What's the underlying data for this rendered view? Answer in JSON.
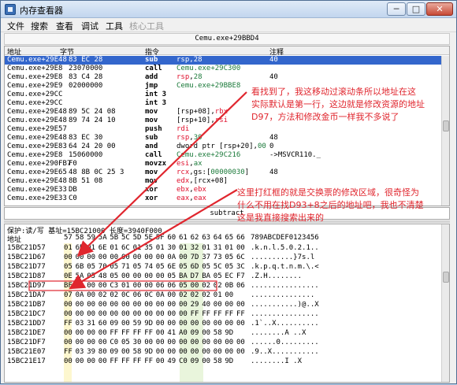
{
  "window": {
    "title": "内存查看器",
    "min_label": "─",
    "max_label": "□",
    "close_label": "✕"
  },
  "menu": [
    "文件",
    "搜索",
    "查看",
    "调试",
    "工具",
    "核心工具"
  ],
  "disasm": {
    "address_label": "Cemu.exe+29BBD4",
    "headers": {
      "address": "地址",
      "bytes": "字节",
      "opcode": "指令",
      "comment": "注释"
    },
    "rows": [
      {
        "addr": "Cemu.exe+29E48",
        "bytes": "83 EC 28",
        "mn": "sub",
        "op": [
          [
            "reg",
            "rsp"
          ],
          [
            "",
            ","
          ],
          [
            "num",
            "28"
          ]
        ],
        "cm": "40"
      },
      {
        "addr": "Cemu.exe+29E8",
        "bytes": "23070000",
        "mn": "call",
        "op": [
          [
            "grn",
            "Cemu.exe+29C300"
          ]
        ],
        "cm": ""
      },
      {
        "addr": "Cemu.exe+29E8",
        "bytes": "83 C4 28",
        "mn": "add",
        "op": [
          [
            "reg",
            "rsp"
          ],
          [
            "",
            ","
          ],
          [
            "num",
            "28"
          ]
        ],
        "cm": "40"
      },
      {
        "addr": "Cemu.exe+29E9",
        "bytes": "02000000",
        "mn": "jmp",
        "op": [
          [
            "grn",
            "Cemu.exe+29BBE8"
          ]
        ],
        "cm": ""
      },
      {
        "addr": "Cemu.exe+29CC",
        "bytes": "",
        "mn": "int 3",
        "op": [],
        "cm": ""
      },
      {
        "addr": "Cemu.exe+29CC",
        "bytes": "",
        "mn": "int 3",
        "op": [],
        "cm": ""
      },
      {
        "addr": "Cemu.exe+29E48",
        "bytes": "89 5C 24 08",
        "mn": "mov",
        "op": [
          [
            "",
            "[rsp+08],"
          ],
          [
            "reg",
            "rbx"
          ]
        ],
        "cm": ""
      },
      {
        "addr": "Cemu.exe+29E48",
        "bytes": "89 74 24 10",
        "mn": "mov",
        "op": [
          [
            "",
            "[rsp+10],"
          ],
          [
            "reg",
            "rsi"
          ]
        ],
        "cm": ""
      },
      {
        "addr": "Cemu.exe+29E57",
        "bytes": "",
        "mn": "push",
        "op": [
          [
            "reg",
            "rdi"
          ]
        ],
        "cm": ""
      },
      {
        "addr": "Cemu.exe+29E48",
        "bytes": "83 EC 30",
        "mn": "sub",
        "op": [
          [
            "reg",
            "rsp"
          ],
          [
            "",
            ","
          ],
          [
            "num",
            "30"
          ]
        ],
        "cm": "48"
      },
      {
        "addr": "Cemu.exe+29E83",
        "bytes": "64 24 20 00",
        "mn": "and",
        "op": [
          [
            "",
            "dword ptr [rsp+20],"
          ],
          [
            "num",
            "00"
          ]
        ],
        "cm": "0"
      },
      {
        "addr": "Cemu.exe+29E8",
        "bytes": "15060000",
        "mn": "call",
        "op": [
          [
            "grn",
            "Cemu.exe+29C216"
          ]
        ],
        "cm": "->MSVCR110._"
      },
      {
        "addr": "Cemu.exe+290FB7",
        "bytes": "F0",
        "mn": "movzx",
        "op": [
          [
            "reg",
            "esi"
          ],
          [
            "",
            ","
          ],
          [
            "num",
            "ax"
          ]
        ],
        "cm": ""
      },
      {
        "addr": "Cemu.exe+29E65",
        "bytes": "48 8B 0C 25 3",
        "mn": "mov",
        "op": [
          [
            "reg",
            "rcx"
          ],
          [
            "",
            ",gs:["
          ],
          [
            "num",
            "00000030"
          ],
          [
            "",
            "]"
          ]
        ],
        "cm": "48"
      },
      {
        "addr": "Cemu.exe+29E48",
        "bytes": "8B 51 08",
        "mn": "mov",
        "op": [
          [
            "reg",
            "edx"
          ],
          [
            "",
            ",[rcx+08]"
          ]
        ],
        "cm": ""
      },
      {
        "addr": "Cemu.exe+29E33",
        "bytes": "DB",
        "mn": "xor",
        "op": [
          [
            "reg",
            "ebx"
          ],
          [
            "",
            ","
          ],
          [
            "reg",
            "ebx"
          ]
        ],
        "cm": ""
      },
      {
        "addr": "Cemu.exe+29E33",
        "bytes": "C0",
        "mn": "xor",
        "op": [
          [
            "reg",
            "eax"
          ],
          [
            "",
            ","
          ],
          [
            "reg",
            "eax"
          ]
        ],
        "cm": ""
      }
    ],
    "status": "subtract"
  },
  "hex": {
    "info": "保护:读/写  基址=15BC21000 长度=3940F000",
    "header_addr": "地址",
    "header_cols": [
      "57",
      "58",
      "59",
      "5A",
      "5B",
      "5C",
      "5D",
      "5E",
      "5F",
      "60",
      "61",
      "62",
      "63",
      "64",
      "65",
      "66"
    ],
    "header_ascii": "789ABCDEF0123456",
    "rows": [
      {
        "addr": "15BC21D57",
        "bytes": [
          "01",
          "6B",
          "01",
          "6E",
          "01",
          "6C",
          "01",
          "35",
          "01",
          "30",
          "01",
          "32",
          "01",
          "31",
          "01",
          "00"
        ],
        "ascii": ".k.n.l.5.0.2.1.."
      },
      {
        "addr": "15BC21D67",
        "bytes": [
          "00",
          "00",
          "00",
          "00",
          "00",
          "00",
          "00",
          "00",
          "00",
          "0A",
          "00",
          "7D",
          "37",
          "73",
          "05",
          "6C"
        ],
        "ascii": "..........}7s.l"
      },
      {
        "addr": "15BC21D77",
        "bytes": [
          "05",
          "6B",
          "05",
          "70",
          "05",
          "71",
          "05",
          "74",
          "05",
          "6E",
          "05",
          "6D",
          "05",
          "5C",
          "05",
          "3C"
        ],
        "ascii": ".k.p.q.t.n.m.\\.<"
      },
      {
        "addr": "15BC21D87",
        "bytes": [
          "0E",
          "5A",
          "05",
          "48",
          "05",
          "00",
          "00",
          "00",
          "00",
          "05",
          "BA",
          "D7",
          "BA",
          "05",
          "EC",
          "F7"
        ],
        "ascii": ".Z.H........"
      },
      {
        "addr": "15BC21D97",
        "bytes": [
          "BF",
          "00",
          "00",
          "00",
          "C3",
          "01",
          "00",
          "00",
          "06",
          "06",
          "05",
          "00",
          "02",
          "02",
          "0B",
          "06"
        ],
        "ascii": "................"
      },
      {
        "addr": "15BC21DA7",
        "bytes": [
          "07",
          "0A",
          "00",
          "02",
          "02",
          "0C",
          "06",
          "0C",
          "0A",
          "00",
          "02",
          "02",
          "02",
          "01",
          "00"
        ],
        "ascii": "..............."
      },
      {
        "addr": "15BC21DB7",
        "bytes": [
          "00",
          "00",
          "00",
          "00",
          "00",
          "00",
          "00",
          "00",
          "00",
          "00",
          "00",
          "29",
          "40",
          "00",
          "00",
          "00"
        ],
        "ascii": "...........)@..X"
      },
      {
        "addr": "15BC21DC7",
        "bytes": [
          "00",
          "00",
          "00",
          "00",
          "00",
          "00",
          "00",
          "00",
          "00",
          "00",
          "00",
          "FF",
          "FF",
          "FF",
          "FF",
          "FF"
        ],
        "ascii": "................"
      },
      {
        "addr": "15BC21DD7",
        "bytes": [
          "FF",
          "03",
          "31",
          "60",
          "09",
          "00",
          "59",
          "9D",
          "00",
          "00",
          "00",
          "00",
          "00",
          "00",
          "00",
          "00"
        ],
        "ascii": ".1`..X.........."
      },
      {
        "addr": "15BC21DE7",
        "bytes": [
          "00",
          "00",
          "00",
          "00",
          "FF",
          "FF",
          "FF",
          "FF",
          "00",
          "41",
          "A0",
          "09",
          "00",
          "58",
          "9D"
        ],
        "ascii": "........A ..X"
      },
      {
        "addr": "15BC21DF7",
        "bytes": [
          "00",
          "00",
          "00",
          "00",
          "C0",
          "05",
          "30",
          "00",
          "00",
          "00",
          "00",
          "00",
          "00",
          "00",
          "00",
          "00"
        ],
        "ascii": "......0........."
      },
      {
        "addr": "15BC21E07",
        "bytes": [
          "FF",
          "03",
          "39",
          "80",
          "09",
          "00",
          "58",
          "9D",
          "00",
          "00",
          "00",
          "00",
          "00",
          "00",
          "00",
          "00"
        ],
        "ascii": ".9..X..........."
      },
      {
        "addr": "15BC21E17",
        "bytes": [
          "00",
          "00",
          "00",
          "00",
          "FF",
          "FF",
          "FF",
          "FF",
          "00",
          "49",
          "C0",
          "09",
          "00",
          "58",
          "9D"
        ],
        "ascii": "........I .X"
      }
    ]
  },
  "annotations": {
    "note1": "看找到了，我这移动过滚动条所以地址在这\n实际默认是第一行，这边就是修改资源的地址\nD97，方法和修改金币一样我不多说了",
    "note2": "这里打红框的就是交换票的修改区域，很奇怪为\n什么不用在找D93+8之后的地址吧，我也不清楚\n这是我直接搜索出来的"
  },
  "colors": {
    "accent": "#3366cc",
    "register": "#e0102d",
    "number": "#1b7a3a",
    "annotation": "#e0262e"
  }
}
